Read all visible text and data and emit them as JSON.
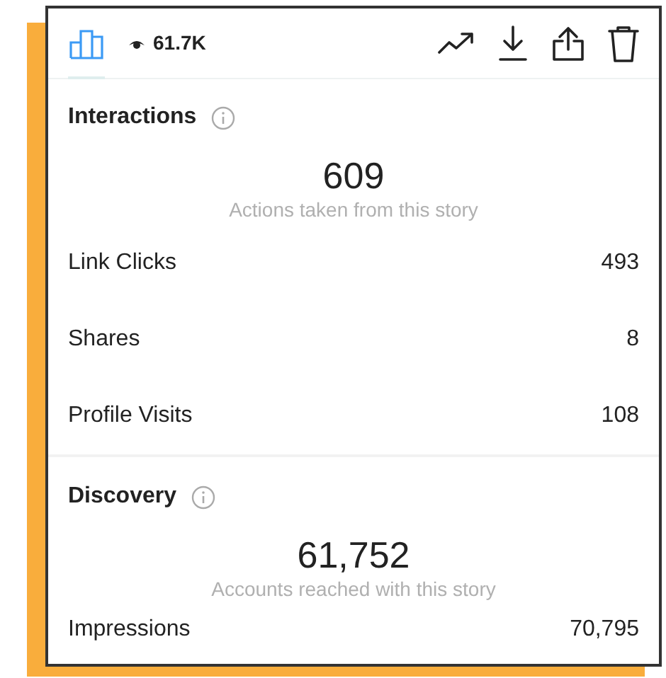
{
  "toolbar": {
    "insights_tab": {
      "selected": true
    },
    "views": "61.7K",
    "actions": [
      {
        "kind": "trend"
      },
      {
        "kind": "download"
      },
      {
        "kind": "share"
      },
      {
        "kind": "delete"
      }
    ]
  },
  "sections": [
    {
      "title": "Interactions",
      "total": "609",
      "caption": "Actions taken from this story",
      "rows": [
        {
          "label": "Link Clicks",
          "value": "493"
        },
        {
          "label": "Shares",
          "value": "8"
        },
        {
          "label": "Profile Visits",
          "value": "108"
        }
      ]
    },
    {
      "title": "Discovery",
      "total": "61,752",
      "caption": "Accounts reached with this story",
      "rows": [
        {
          "label": "Impressions",
          "value": "70,795"
        }
      ]
    }
  ]
}
